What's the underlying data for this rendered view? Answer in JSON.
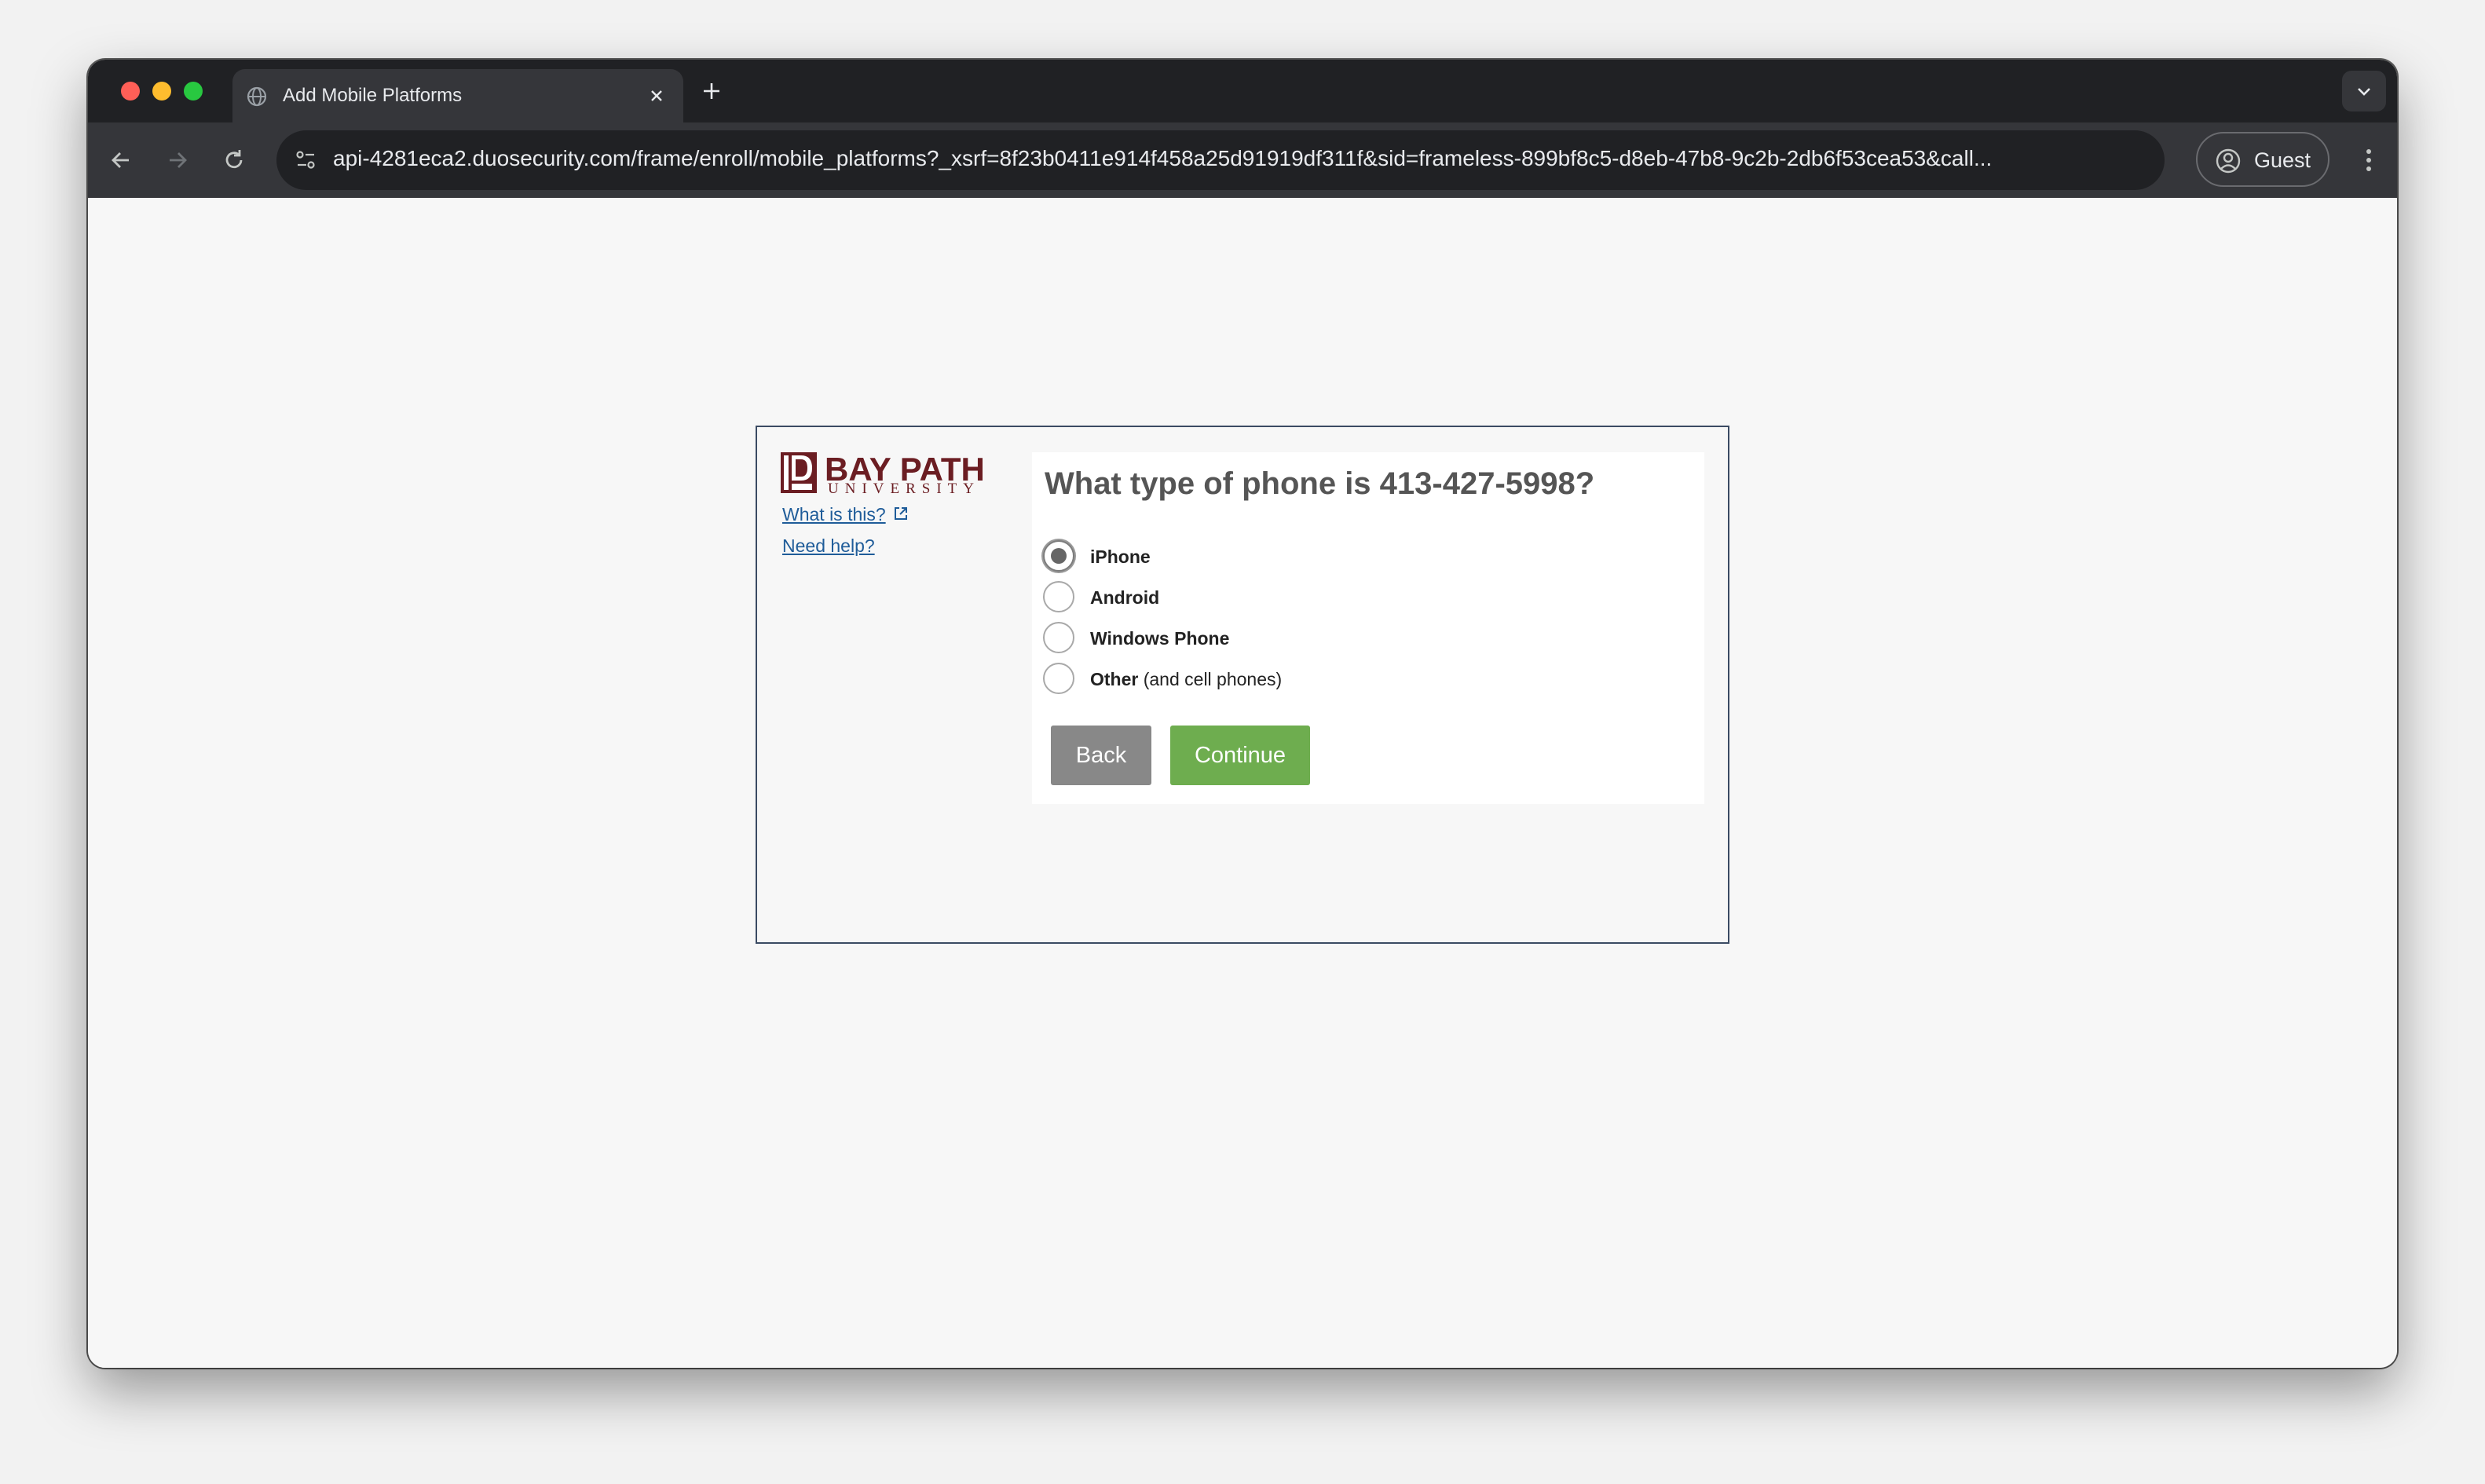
{
  "browser": {
    "tab_title": "Add Mobile Platforms",
    "url": "api-4281eca2.duosecurity.com/frame/enroll/mobile_platforms?_xsrf=8f23b0411e914f458a25d91919df311f&sid=frameless-899bf8c5-d8eb-47b8-9c2b-2db6f53cea53&call...",
    "profile_label": "Guest",
    "icons": [
      "globe-icon",
      "close-icon",
      "plus-icon",
      "chevron-down-icon",
      "back-arrow-icon",
      "forward-arrow-icon",
      "reload-icon",
      "site-info-icon",
      "profile-icon",
      "more-vert-icon"
    ]
  },
  "sidebar": {
    "logo_line1": "BAY PATH",
    "logo_line2": "UNIVERSITY",
    "what_is_this": "What is this?",
    "need_help": "Need help?"
  },
  "prompt": {
    "question": "What type of phone is 413-427-5998?",
    "options": [
      {
        "label": "iPhone",
        "suffix": "",
        "selected": true
      },
      {
        "label": "Android",
        "suffix": "",
        "selected": false
      },
      {
        "label": "Windows Phone",
        "suffix": "",
        "selected": false
      },
      {
        "label": "Other",
        "suffix": "(and cell phones)",
        "selected": false
      }
    ],
    "back_label": "Back",
    "continue_label": "Continue"
  },
  "colors": {
    "brand": "#6b1d22",
    "link": "#1f5c99",
    "continue_button": "#6ead4f",
    "back_button": "#888888",
    "frame_border": "#3b4b63"
  }
}
